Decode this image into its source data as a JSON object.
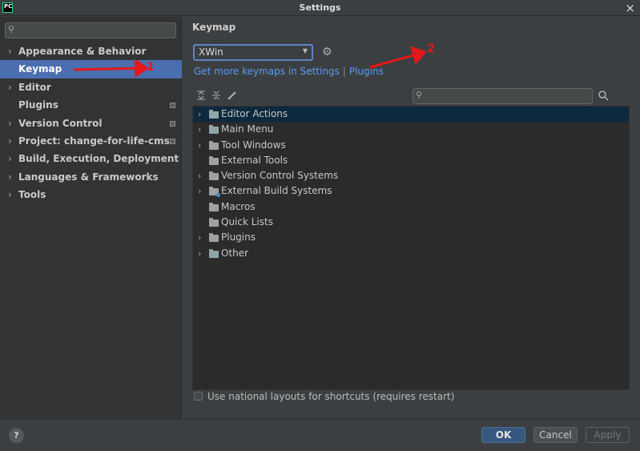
{
  "window": {
    "title": "Settings",
    "app_icon": "PC"
  },
  "sidebar": {
    "search_placeholder": "",
    "items": [
      {
        "label": "Appearance & Behavior",
        "expandable": true
      },
      {
        "label": "Keymap",
        "expandable": false,
        "selected": true
      },
      {
        "label": "Editor",
        "expandable": true
      },
      {
        "label": "Plugins",
        "expandable": false,
        "project_icon": true
      },
      {
        "label": "Version Control",
        "expandable": true,
        "project_icon": true
      },
      {
        "label": "Project: change-for-life-cms",
        "expandable": true,
        "project_icon": true
      },
      {
        "label": "Build, Execution, Deployment",
        "expandable": true
      },
      {
        "label": "Languages & Frameworks",
        "expandable": true
      },
      {
        "label": "Tools",
        "expandable": true
      }
    ]
  },
  "main": {
    "title": "Keymap",
    "keymap_value": "XWin",
    "link_get_more": "Get more keymaps in Settings",
    "link_separator": "|",
    "link_plugins": "Plugins",
    "actions": [
      {
        "label": "Editor Actions",
        "expandable": true,
        "selected": true,
        "icon": "editor-actions-icon"
      },
      {
        "label": "Main Menu",
        "expandable": true,
        "icon": "main-menu-icon"
      },
      {
        "label": "Tool Windows",
        "expandable": true,
        "icon": "folder-icon"
      },
      {
        "label": "External Tools",
        "expandable": false,
        "icon": "folder-icon"
      },
      {
        "label": "Version Control Systems",
        "expandable": true,
        "icon": "folder-icon"
      },
      {
        "label": "External Build Systems",
        "expandable": true,
        "icon": "build-folder-icon"
      },
      {
        "label": "Macros",
        "expandable": false,
        "icon": "folder-icon"
      },
      {
        "label": "Quick Lists",
        "expandable": false,
        "icon": "folder-icon"
      },
      {
        "label": "Plugins",
        "expandable": true,
        "icon": "folder-icon"
      },
      {
        "label": "Other",
        "expandable": true,
        "icon": "other-icon"
      }
    ],
    "national_layouts_label": "Use national layouts for shortcuts (requires restart)",
    "national_layouts_checked": false
  },
  "footer": {
    "help_label": "?",
    "ok_label": "OK",
    "cancel_label": "Cancel",
    "apply_label": "Apply"
  },
  "annotations": {
    "marker_1": "1",
    "marker_2": "2"
  },
  "colors": {
    "selection": "#4b6eaf",
    "link": "#589df6",
    "annotation": "#e41818",
    "ok_button": "#365880"
  }
}
